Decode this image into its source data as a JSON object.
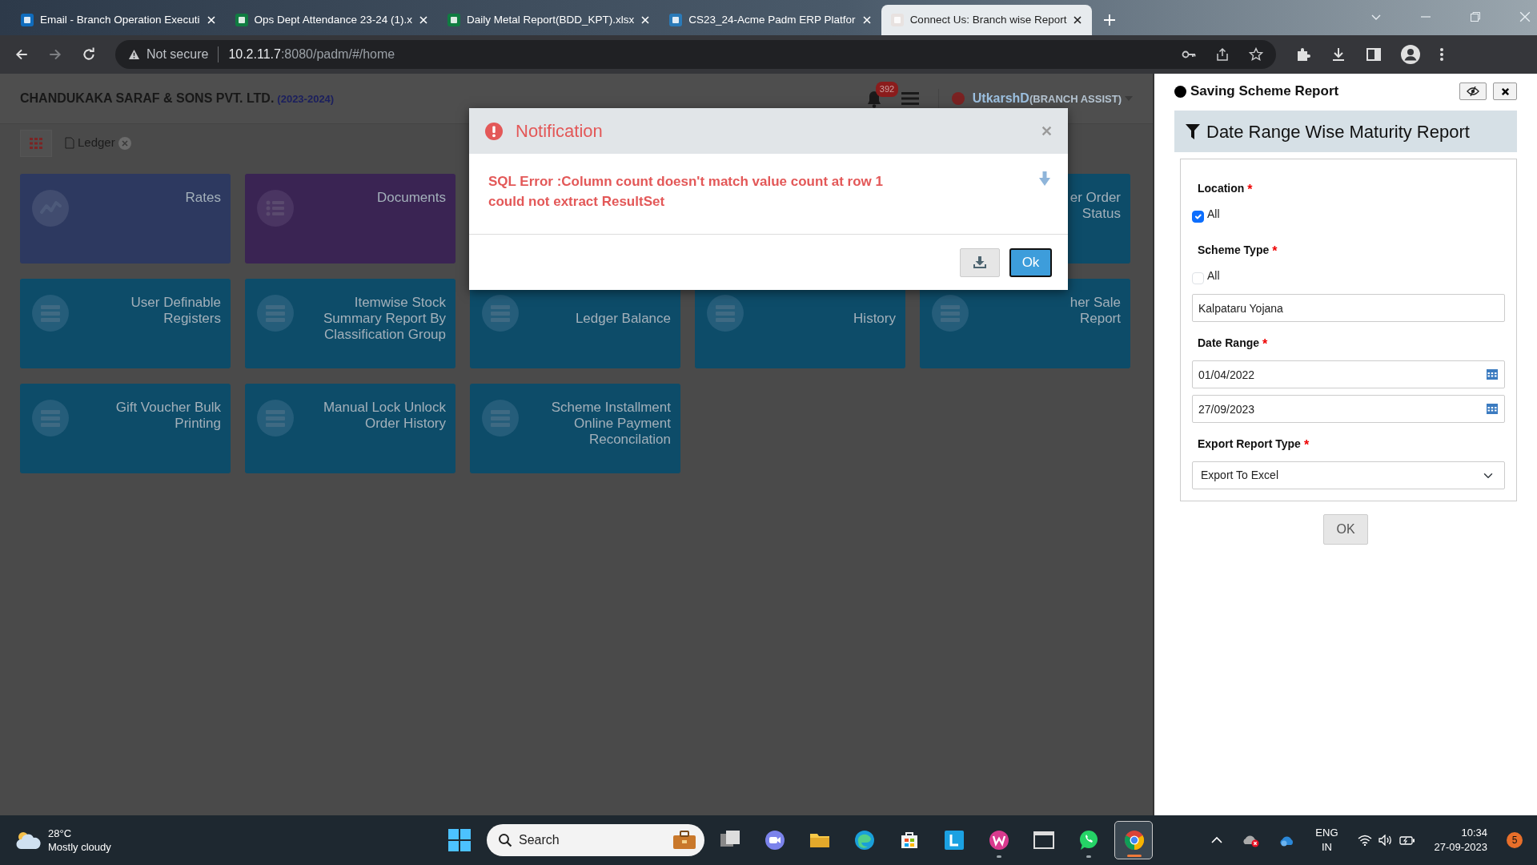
{
  "browser": {
    "tabs": [
      {
        "title": "Email - Branch Operation Executi",
        "selected": false,
        "color": "#0f6cbd"
      },
      {
        "title": "Ops Dept Attendance 23-24 (1).x",
        "selected": false,
        "color": "#107c41"
      },
      {
        "title": "Daily Metal Report(BDD_KPT).xlsx",
        "selected": false,
        "color": "#107c41"
      },
      {
        "title": "CS23_24-Acme Padm ERP Platfor",
        "selected": false,
        "color": "#2a7ab8"
      },
      {
        "title": "Connect Us: Branch wise Report",
        "selected": true,
        "color": "#e8e2e0"
      }
    ],
    "forward_disabled": true,
    "address": {
      "security": "Not secure",
      "host": "10.2.11.7",
      "path": ":8080/padm/#/home"
    }
  },
  "app": {
    "company": "CHANDUKAKA SARAF & SONS PVT. LTD.",
    "year": "(2023-2024)",
    "notification_count": "392",
    "user": "UtkarshD",
    "role": "(BRANCH ASSIST)",
    "breadcrumbs": [
      {
        "label": "Ledger"
      }
    ],
    "tile_rows": [
      [
        {
          "lines": [
            "Rates"
          ],
          "kind": "chart",
          "color": "#2d3960",
          "covered": false
        },
        {
          "lines": [
            "Documents"
          ],
          "kind": "list",
          "color": "#3a2453",
          "covered": false
        },
        null,
        null,
        {
          "lines": [
            "er Order",
            "Status"
          ],
          "kind": "register",
          "color": "#0d4c69",
          "covered": false
        }
      ],
      [
        {
          "lines": [
            "User Definable",
            "Registers"
          ],
          "kind": "register",
          "color": "#0d4c69",
          "covered": false
        },
        {
          "lines": [
            "Itemwise Stock",
            "Summary Report By",
            "Classification Group"
          ],
          "kind": "register",
          "color": "#0d4c69",
          "covered": false
        },
        {
          "lines": [
            "Ledger Balance"
          ],
          "kind": "register",
          "color": "#0d4c69",
          "covered": true
        },
        {
          "lines": [
            "History"
          ],
          "kind": "register",
          "color": "#0d4c69",
          "covered": true
        },
        {
          "lines": [
            "her Sale",
            "Report"
          ],
          "kind": "register",
          "color": "#0d4c69",
          "covered": false
        }
      ],
      [
        {
          "lines": [
            "Gift Voucher Bulk",
            "Printing"
          ],
          "kind": "register",
          "color": "#0d4c69",
          "covered": false
        },
        {
          "lines": [
            "Manual Lock Unlock",
            "Order History"
          ],
          "kind": "register",
          "color": "#0d4c69",
          "covered": false
        },
        {
          "lines": [
            "Scheme Installment",
            "Online Payment",
            "Reconcilation"
          ],
          "kind": "register",
          "color": "#0d4c69",
          "covered": false
        }
      ]
    ]
  },
  "dialog": {
    "title": "Notification",
    "message": [
      "SQL Error :Column count doesn't match value count at row 1",
      "could not extract ResultSet"
    ],
    "ok": "Ok"
  },
  "side_panel": {
    "title": "Saving Scheme Report",
    "report_title": "Date Range Wise Maturity Report",
    "fields": [
      {
        "kind": "checkbox",
        "label": "Location",
        "mark": "*",
        "option": "All",
        "checked": true
      },
      {
        "kind": "checkbox",
        "label": "Scheme Type",
        "mark": "*",
        "option": "All",
        "checked": false
      },
      {
        "kind": "text",
        "value": "Kalpataru Yojana"
      },
      {
        "kind": "date",
        "label": "Date Range",
        "mark": "*",
        "values": [
          "01/04/2022",
          "27/09/2023"
        ]
      },
      {
        "kind": "select",
        "label": "Export Report Type",
        "mark": "*",
        "value": "Export To Excel"
      }
    ],
    "submit": "OK"
  },
  "taskbar": {
    "weather": {
      "temp": "28°C",
      "text": "Mostly cloudy"
    },
    "search": "Search",
    "apps": [
      {
        "kind": "files",
        "running": false,
        "selected": false
      },
      {
        "kind": "chat",
        "running": false,
        "selected": false
      },
      {
        "kind": "folder",
        "running": false,
        "selected": false
      },
      {
        "kind": "edge",
        "running": false,
        "selected": false
      },
      {
        "kind": "store",
        "running": false,
        "selected": false
      },
      {
        "kind": "letter",
        "running": false,
        "selected": false
      },
      {
        "kind": "pink",
        "running": true,
        "selected": false
      },
      {
        "kind": "window",
        "running": false,
        "selected": false
      },
      {
        "kind": "phone",
        "running": true,
        "selected": false
      },
      {
        "kind": "chrome",
        "running": true,
        "selected": true
      }
    ],
    "lang": "ENG",
    "region": "IN",
    "time": "10:34",
    "date": "27-09-2023",
    "notifications": "5"
  }
}
